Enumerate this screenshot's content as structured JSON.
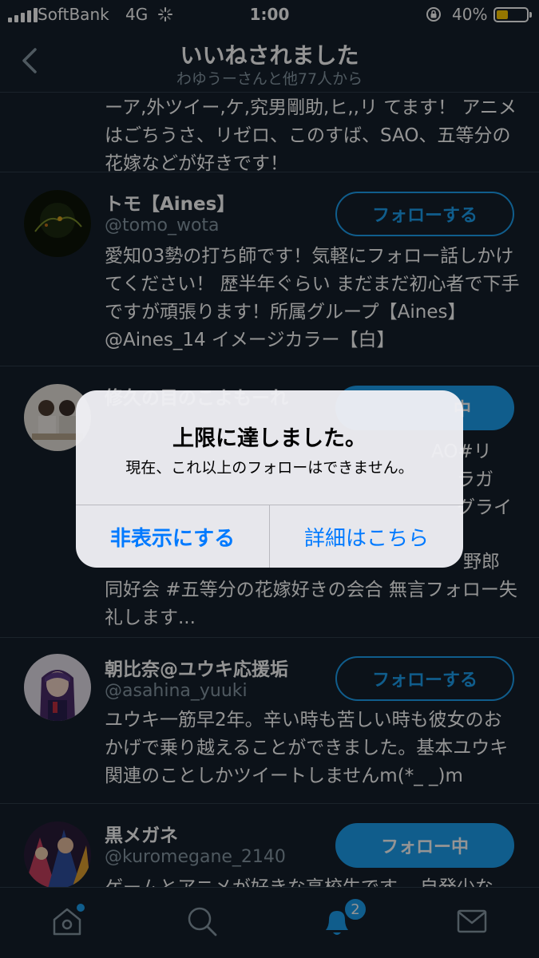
{
  "status_bar": {
    "carrier": "SoftBank",
    "network": "4G",
    "time": "1:00",
    "battery_percent": "40%",
    "battery_level": 0.4,
    "battery_color": "#ffcc00",
    "lock_icon": "orientation-lock-icon"
  },
  "header": {
    "title": "いいねされました",
    "subtitle": "わゆうーさんと他77人から",
    "back_icon": "chevron-left-icon"
  },
  "users": [
    {
      "name": "",
      "handle": "",
      "bio": "ーア,外ツイー,ケ,究男剛助,ヒ,,リ てます！ アニメはごちうさ、リゼロ、このすば、SAO、五等分の花嫁などが好きです！",
      "button": ""
    },
    {
      "name": "トモ【Aines】",
      "handle": "@tomo_wota",
      "bio": "愛知03勢の打ち師です！気軽にフォロー話しかけてください！ 歴半年ぐらい まだまだ初心者で下手ですが頑張ります！所属グループ【Aines】@Aines_14 イメージカラー【白】",
      "button": "フォローする"
    },
    {
      "name": "修久の目のこよもーれ",
      "handle": "",
      "bio_lines": [
        "AO#リ",
        "ラガ",
        "グライ",
        "野郎"
      ],
      "bio_tail": "同好会 #五等分の花嫁好きの会合 無言フォロー失礼します...",
      "button": "中"
    },
    {
      "name": "朝比奈@ユウキ応援垢",
      "handle": "@asahina_yuuki",
      "bio": "ユウキ一筋早2年。辛い時も苦しい時も彼女のおかげで乗り越えることができました。基本ユウキ関連のことしかツイートしませんm(*_ _)m",
      "button": "フォローする"
    },
    {
      "name": "黒メガネ",
      "handle": "@kuromegane_2140",
      "bio": "ゲームとアニメが好きな高校生です。 自発少な",
      "button": "フォロー中"
    }
  ],
  "alert": {
    "title": "上限に達しました。",
    "message": "現在、これ以上のフォローはできません。",
    "dismiss_label": "非表示にする",
    "details_label": "詳細はこちら"
  },
  "tabbar": {
    "items": [
      "home-icon",
      "search-icon",
      "bell-icon",
      "mail-icon"
    ],
    "notification_count": "2"
  },
  "colors": {
    "background": "#15202b",
    "accent": "#1da1f2",
    "secondary_text": "#8899a6",
    "alert_button": "#007aff"
  }
}
